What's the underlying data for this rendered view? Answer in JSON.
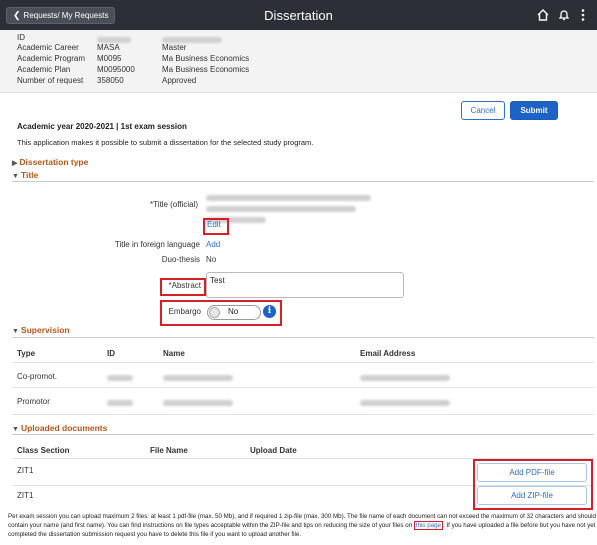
{
  "header": {
    "back_label": "Requests/ My Requests",
    "title": "Dissertation",
    "icons": [
      "home-icon",
      "bell-icon",
      "more-vertical-icon"
    ]
  },
  "info": {
    "id_label": "ID",
    "rows": [
      {
        "label": "Academic Career",
        "code": "MASA",
        "value": "Master"
      },
      {
        "label": "Academic Program",
        "code": "M0095",
        "value": "Ma Business Economics"
      },
      {
        "label": "Academic Plan",
        "code": "M0095000",
        "value": "Ma Business Economics"
      },
      {
        "label": "Number of request",
        "code": "358050",
        "value": "Approved"
      }
    ]
  },
  "actions": {
    "cancel": "Cancel",
    "submit": "Submit"
  },
  "session": {
    "heading": "Academic year 2020-2021 | 1st exam session",
    "intro": "This application makes it possible to submit a dissertation for the selected study program."
  },
  "sections": {
    "dissertation_type": "Dissertation type",
    "title": "Title",
    "supervision": "Supervision",
    "uploaded": "Uploaded documents"
  },
  "title_form": {
    "title_official_label": "*Title (official)",
    "edit_link": "Edit",
    "foreign_label": "Title in foreign language",
    "foreign_link": "Add",
    "duo_label": "Duo-thesis",
    "duo_value": "No",
    "abstract_label": "*Abstract",
    "abstract_value": "Test",
    "embargo_label": "Embargo",
    "embargo_value": "No"
  },
  "supervision": {
    "headers": {
      "type": "Type",
      "id": "ID",
      "name": "Name",
      "email": "Email Address"
    },
    "rows": [
      {
        "type": "Co-promot."
      },
      {
        "type": "Promotor"
      }
    ]
  },
  "uploads": {
    "headers": {
      "class": "Class Section",
      "file": "File Name",
      "date": "Upload Date"
    },
    "rows": [
      {
        "class": "ZIT1",
        "button": "Add PDF-file"
      },
      {
        "class": "ZIT1",
        "button": "Add ZIP-file"
      }
    ]
  },
  "footer": {
    "text_before": "Per exam session you can upload maximum 2 files: at least 1 pdf-file (max. 50 Mb), and if required 1 zip-file (max. 300 Mb). The file name of each document can not exceed the maximum of 32 characters and should contain your name (and first name). You can find instructions on file types acceptable within the ZIP-file and tips on reducing the size of your files on",
    "link": "this page",
    "text_after": ". If you have uploaded a file before but you have not yet completed the dissertation submission request you have to delete this file if you want to upload another file."
  }
}
